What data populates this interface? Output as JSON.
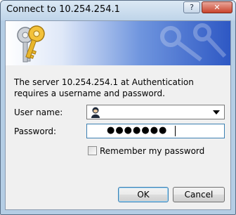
{
  "window": {
    "title": "Connect to 10.254.254.1",
    "help_glyph": "?",
    "close_glyph": "✕"
  },
  "prompt": {
    "message": "The server 10.254.254.1 at Authentication requires a username and password."
  },
  "form": {
    "username_label": "User name:",
    "username_value": "",
    "password_label": "Password:",
    "password_value": "●●●●●●●",
    "remember_label": "Remember my password",
    "remember_checked": false
  },
  "buttons": {
    "ok": "OK",
    "cancel": "Cancel"
  },
  "colors": {
    "banner_dark": "#2e58c4",
    "banner_light": "#dfe8f8",
    "focus_border": "#3c7fb1"
  }
}
